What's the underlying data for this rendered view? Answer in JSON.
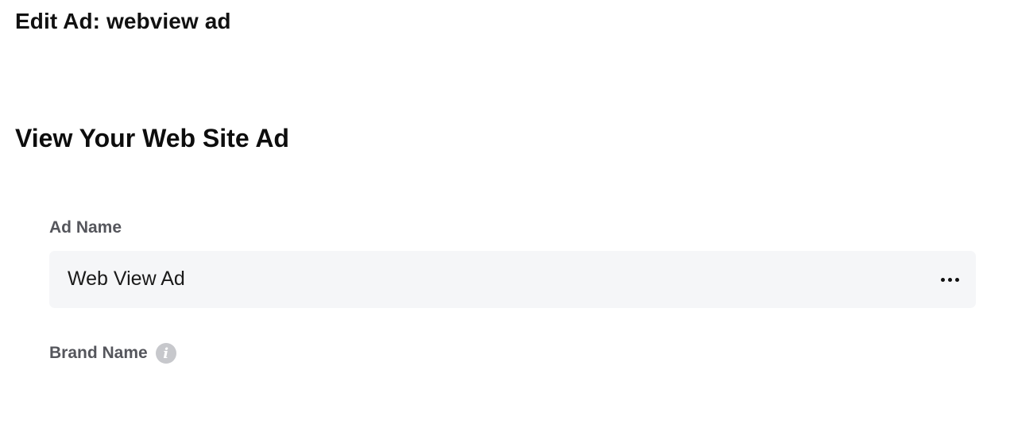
{
  "header": {
    "title": "Edit Ad: webview ad"
  },
  "section": {
    "title": "View Your Web Site Ad"
  },
  "form": {
    "ad_name": {
      "label": "Ad Name",
      "value": "Web View Ad",
      "more_icon": "more-horizontal-icon"
    },
    "brand_name": {
      "label": "Brand Name",
      "info_icon": "info-icon",
      "info_glyph": "i"
    }
  },
  "colors": {
    "label_text": "#55565c",
    "input_bg": "#f5f6f8",
    "info_icon_bg": "#c7c8cc"
  }
}
